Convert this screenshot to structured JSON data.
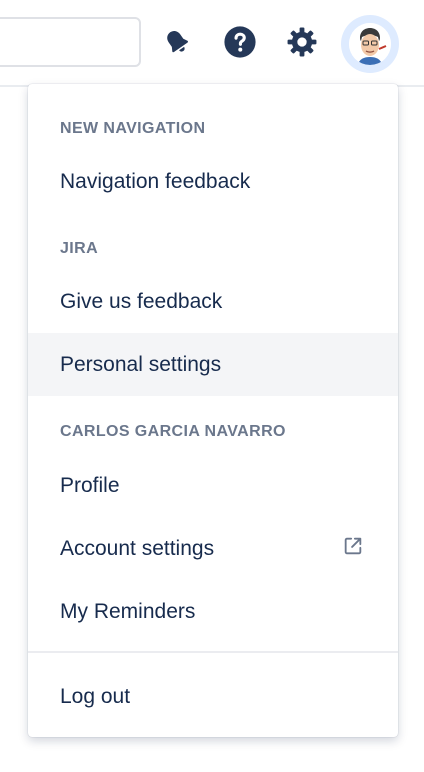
{
  "topbar": {
    "search": {
      "placeholder": ""
    },
    "icons": [
      "notification-bell-icon",
      "help-icon",
      "settings-gear-icon"
    ],
    "avatar_label": "User avatar"
  },
  "menu": {
    "sections": [
      {
        "title": "NEW NAVIGATION",
        "items": [
          {
            "label": "Navigation feedback"
          }
        ]
      },
      {
        "title": "JIRA",
        "items": [
          {
            "label": "Give us feedback"
          },
          {
            "label": "Personal settings"
          }
        ]
      },
      {
        "title": "CARLOS GARCIA NAVARRO",
        "items": [
          {
            "label": "Profile"
          },
          {
            "label": "Account settings",
            "external": true
          },
          {
            "label": "My Reminders"
          }
        ]
      }
    ],
    "logout_label": "Log out"
  },
  "colors": {
    "text": "#172b4d",
    "section_title": "#6b778c",
    "hover": "#f4f5f7",
    "icon": "#253858",
    "avatar_ring": "#deebff"
  }
}
